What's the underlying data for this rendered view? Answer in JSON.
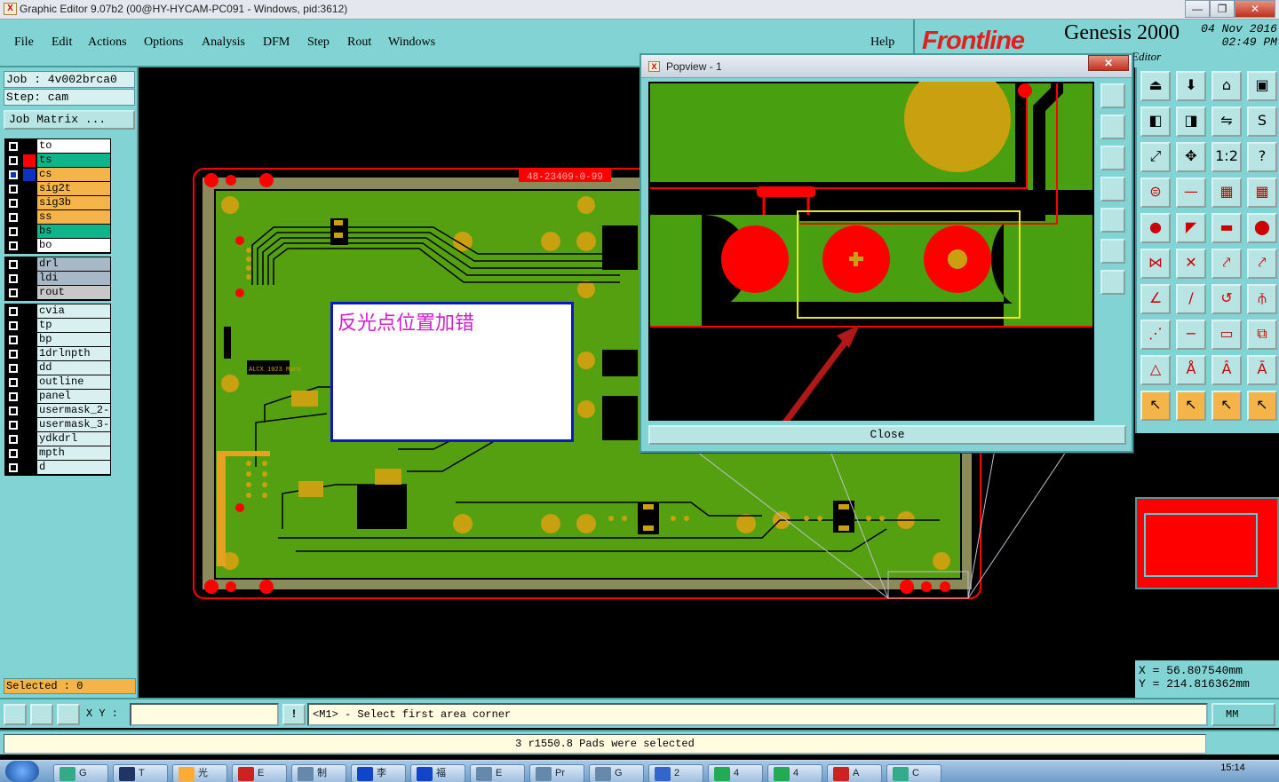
{
  "window": {
    "title": "Graphic Editor 9.07b2 (00@HY-HYCAM-PC091 - Windows, pid:3612)",
    "icon_text": "X",
    "controls": [
      "minimize",
      "maximize",
      "close"
    ],
    "minimize_label": "—",
    "maximize_label": "❐",
    "close_label": "✕"
  },
  "menu": {
    "items": [
      "File",
      "Edit",
      "Actions",
      "Options",
      "Analysis",
      "DFM",
      "Step",
      "Rout",
      "Windows"
    ],
    "help": "Help"
  },
  "branding": {
    "logo": "Frontline",
    "product": "Genesis 2000",
    "date": "04 Nov 2016",
    "time": "02:49 PM",
    "editor": "Editor"
  },
  "job": {
    "job_label": "Job : 4v002brca0",
    "step_label": "Step: cam",
    "matrix_button": "Job Matrix ..."
  },
  "layers": {
    "groups": [
      [
        {
          "name": "to",
          "bg": "#ffffff",
          "swatch": "#000000"
        },
        {
          "name": "ts",
          "bg": "#10b48a",
          "swatch": "#ff0000"
        },
        {
          "name": "cs",
          "bg": "#f4b44a",
          "swatch": "#1030c0",
          "active": true
        },
        {
          "name": "sig2t",
          "bg": "#f4b44a",
          "swatch": "#000000"
        },
        {
          "name": "sig3b",
          "bg": "#f4b44a",
          "swatch": "#000000"
        },
        {
          "name": "ss",
          "bg": "#f4b44a",
          "swatch": "#000000"
        },
        {
          "name": "bs",
          "bg": "#10b48a",
          "swatch": "#000000"
        },
        {
          "name": "bo",
          "bg": "#ffffff",
          "swatch": "#000000"
        }
      ],
      [
        {
          "name": "drl",
          "bg": "#a8b8c8",
          "swatch": "#000000"
        },
        {
          "name": "ldi",
          "bg": "#a8b8c8",
          "swatch": "#000000"
        },
        {
          "name": "rout",
          "bg": "#c8c8c8",
          "swatch": "#000000"
        }
      ],
      [
        {
          "name": "cvia",
          "bg": "#d8f0f0",
          "swatch": "#000000"
        },
        {
          "name": "tp",
          "bg": "#d8f0f0",
          "swatch": "#000000"
        },
        {
          "name": "bp",
          "bg": "#d8f0f0",
          "swatch": "#000000"
        },
        {
          "name": "1drlnpth",
          "bg": "#d8f0f0",
          "swatch": "#000000"
        },
        {
          "name": "dd",
          "bg": "#d8f0f0",
          "swatch": "#000000"
        },
        {
          "name": "outline",
          "bg": "#d8f0f0",
          "swatch": "#000000"
        },
        {
          "name": "panel",
          "bg": "#d8f0f0",
          "swatch": "#000000"
        },
        {
          "name": "usermask_2-",
          "bg": "#d8f0f0",
          "swatch": "#000000"
        },
        {
          "name": "usermask_3-",
          "bg": "#d8f0f0",
          "swatch": "#000000"
        },
        {
          "name": "ydkdrl",
          "bg": "#d8f0f0",
          "swatch": "#000000"
        },
        {
          "name": "mpth",
          "bg": "#d8f0f0",
          "swatch": "#000000"
        },
        {
          "name": "d",
          "bg": "#d8f0f0",
          "swatch": "#000000"
        }
      ]
    ]
  },
  "selected": "Selected : 0",
  "board": {
    "part_number": "48-23409-0-99",
    "silkscreen_text": "ALCX 1023 Mark"
  },
  "annotation": {
    "text": "反光点位置加错"
  },
  "popview": {
    "title": "Popview - 1",
    "close_x": "✕",
    "close_button": "Close"
  },
  "coords": {
    "x": "X = 56.807540mm",
    "y": "Y = 214.816362mm"
  },
  "command": {
    "xy_label": "X Y :",
    "xy_value": "",
    "warn_icon": "!",
    "prompt": "<M1> - Select first area corner",
    "units": "MM"
  },
  "status": {
    "message": "3 r1550.8 Pads were selected"
  },
  "taskbar": {
    "items": [
      "G",
      "T",
      "光",
      "E",
      "制",
      "李",
      "福",
      "E",
      "Pr",
      "G",
      "2",
      "4",
      "4",
      "A",
      "C"
    ],
    "clock": "15:14"
  }
}
